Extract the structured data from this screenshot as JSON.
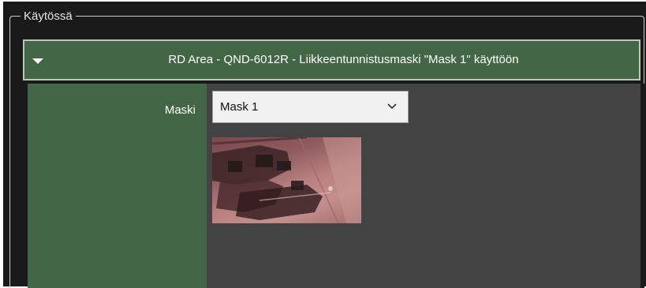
{
  "section": {
    "legend": "Käytössä"
  },
  "header": {
    "title": "RD Area - QND-6012R - Liikkeentunnistusmaski \"Mask 1\" käyttöön"
  },
  "form": {
    "mask_label": "Maski",
    "mask_select_value": "Mask 1"
  },
  "preview": {
    "description_icon": "camera-preview-thumbnail"
  },
  "colors": {
    "panel_green": "#426646",
    "content_gray": "#434343",
    "window_bg": "#1a1a1a"
  }
}
